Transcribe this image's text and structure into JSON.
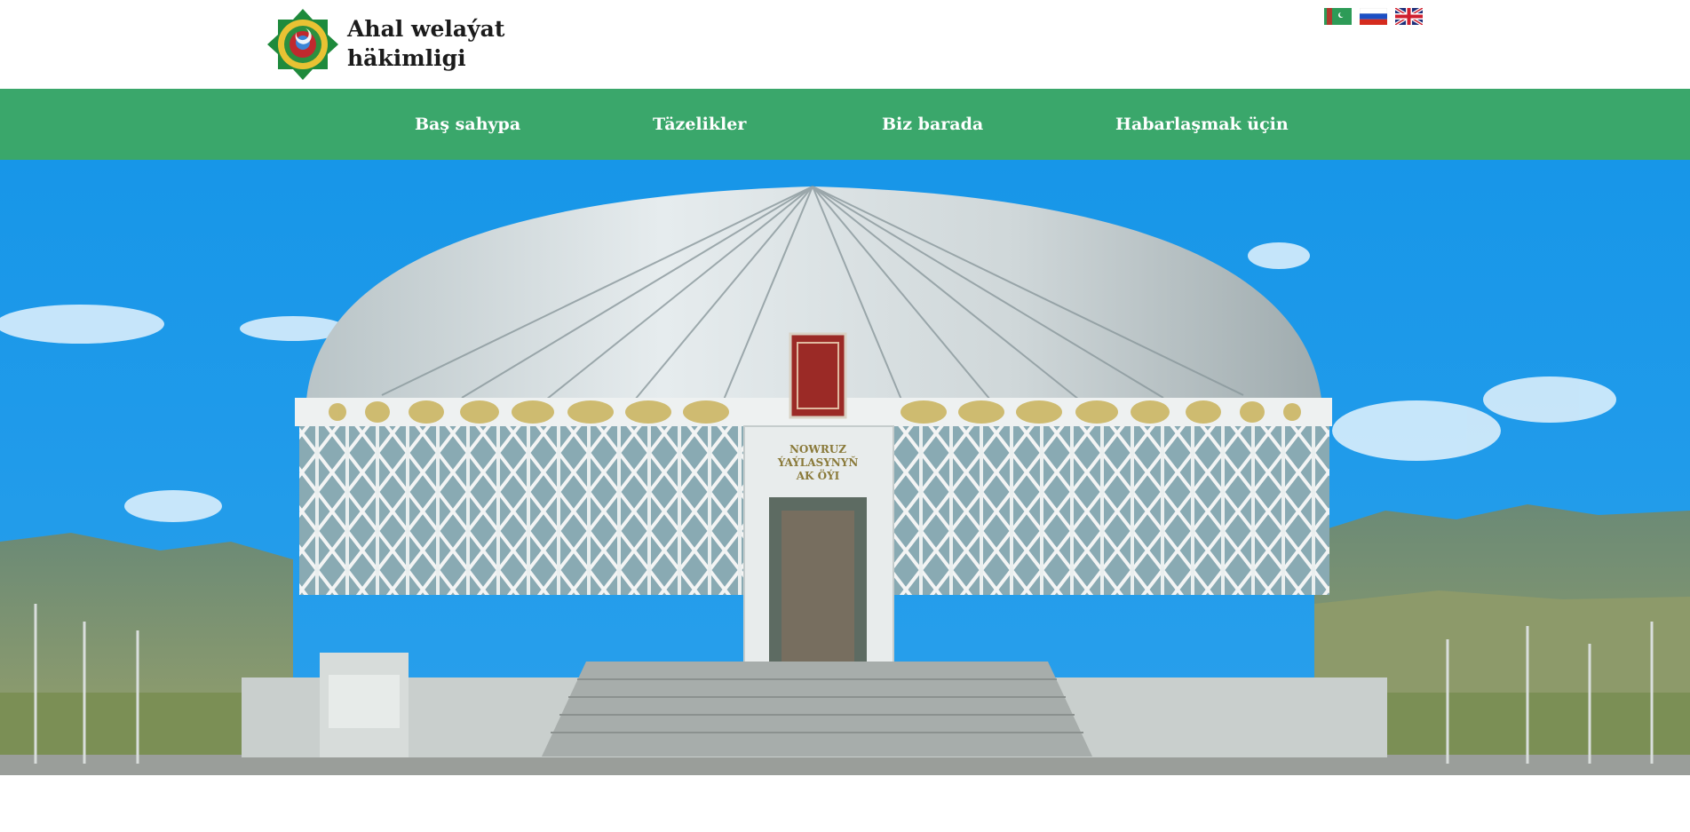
{
  "header": {
    "title_line1": "Ahal welaýat",
    "title_line2": "häkimligi",
    "logo_icon": "emblem-of-turkmenistan-icon"
  },
  "languages": [
    {
      "code": "tk",
      "icon": "turkmenistan-flag-icon"
    },
    {
      "code": "ru",
      "icon": "russia-flag-icon"
    },
    {
      "code": "en",
      "icon": "uk-flag-icon"
    }
  ],
  "nav": {
    "items": [
      {
        "label": "Baş sahypa"
      },
      {
        "label": "Täzelikler"
      },
      {
        "label": "Biz barada"
      },
      {
        "label": "Habarlaşmak üçin"
      }
    ]
  },
  "hero": {
    "building_sign_line1": "NOWRUZ",
    "building_sign_line2": "ÝAÝLASYNYŇ",
    "building_sign_line3": "AK ÖÝI"
  },
  "colors": {
    "nav_background": "#3aa76b",
    "nav_text": "#ffffff",
    "sky": "#1b93e6"
  }
}
